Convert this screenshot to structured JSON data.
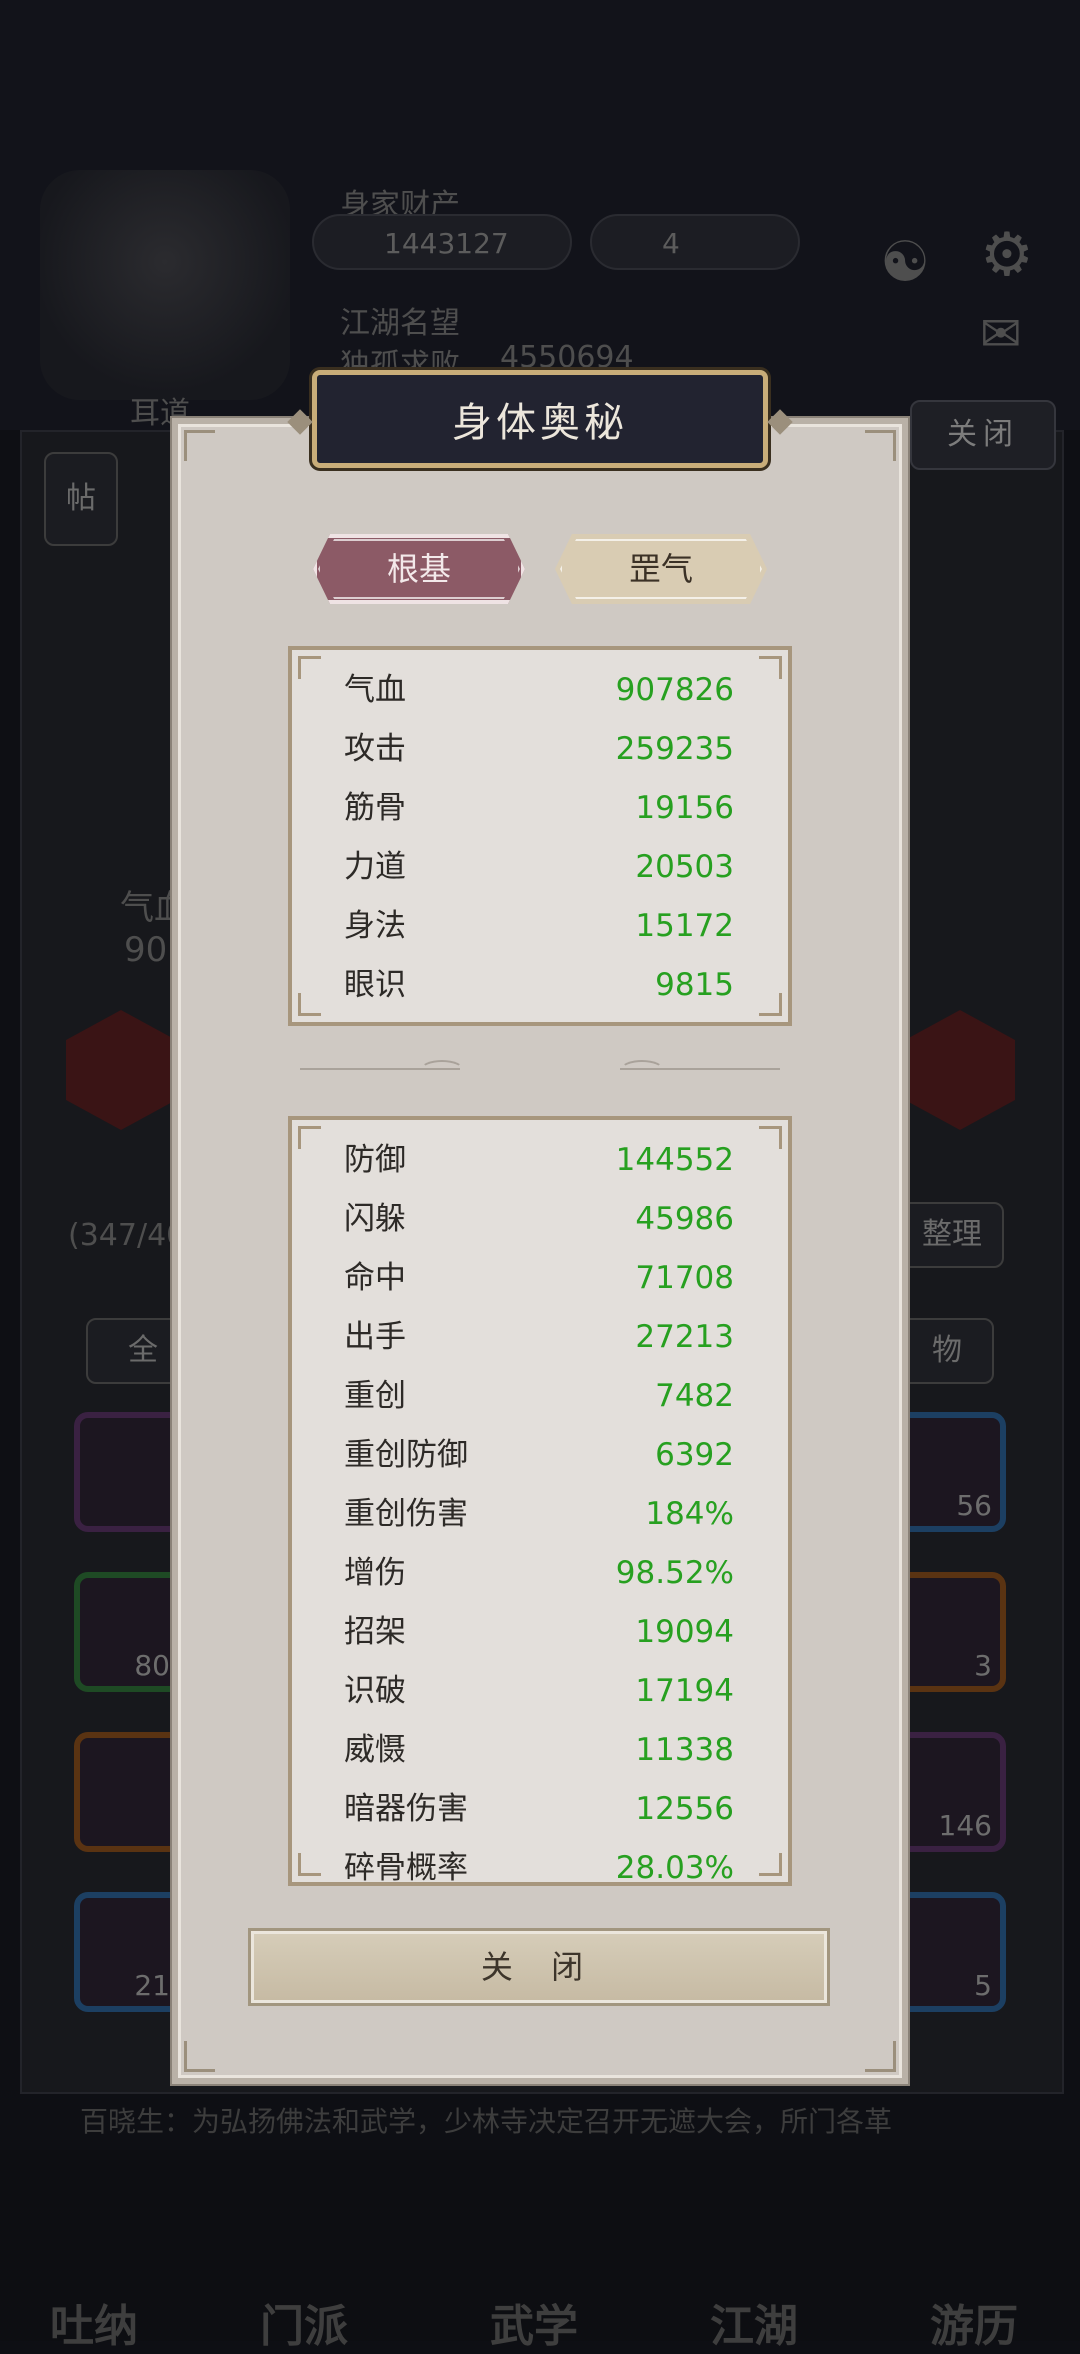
{
  "background": {
    "assets_label": "身家财产",
    "gold": "1443127",
    "gems": "4",
    "reputation_label": "江湖名望",
    "reputation_title": "独孤求败",
    "reputation_value": "4550694",
    "close_label": "关闭",
    "left_label": "耳道",
    "post_label": "帖",
    "hp_short": "气血",
    "hp_partial": "90",
    "inventory_count": "(347/40",
    "sort_label": "整理",
    "filter_all": "全",
    "filter_items": "物",
    "slot_counts": [
      "80",
      "56",
      "3",
      "146",
      "21",
      "5"
    ],
    "ticker": "百晓生：为弘扬佛法和武学，少林寺决定召开无遮大会，所门各革",
    "nav": [
      "吐纳",
      "门派",
      "武学",
      "江湖",
      "游历"
    ]
  },
  "modal": {
    "title": "身体奥秘",
    "tabs": [
      {
        "label": "根基",
        "active": true
      },
      {
        "label": "罡气",
        "active": false
      }
    ],
    "base_stats": [
      {
        "label": "气血",
        "value": "907826"
      },
      {
        "label": "攻击",
        "value": "259235"
      },
      {
        "label": "筋骨",
        "value": "19156"
      },
      {
        "label": "力道",
        "value": "20503"
      },
      {
        "label": "身法",
        "value": "15172"
      },
      {
        "label": "眼识",
        "value": "9815"
      }
    ],
    "advanced_stats": [
      {
        "label": "防御",
        "value": "144552"
      },
      {
        "label": "闪躲",
        "value": "45986"
      },
      {
        "label": "命中",
        "value": "71708"
      },
      {
        "label": "出手",
        "value": "27213"
      },
      {
        "label": "重创",
        "value": "7482"
      },
      {
        "label": "重创防御",
        "value": "6392"
      },
      {
        "label": "重创伤害",
        "value": "184%"
      },
      {
        "label": "增伤",
        "value": "98.52%"
      },
      {
        "label": "招架",
        "value": "19094"
      },
      {
        "label": "识破",
        "value": "17194"
      },
      {
        "label": "威慑",
        "value": "11338"
      },
      {
        "label": "暗器伤害",
        "value": "12556"
      },
      {
        "label": "碎骨概率",
        "value": "28.03%"
      }
    ],
    "close_button": "关 闭"
  },
  "colors": {
    "stat_value": "#27a020",
    "active_tab": "#8c5a66",
    "inactive_tab": "#d9ccb3",
    "title_plate": "#222330"
  }
}
